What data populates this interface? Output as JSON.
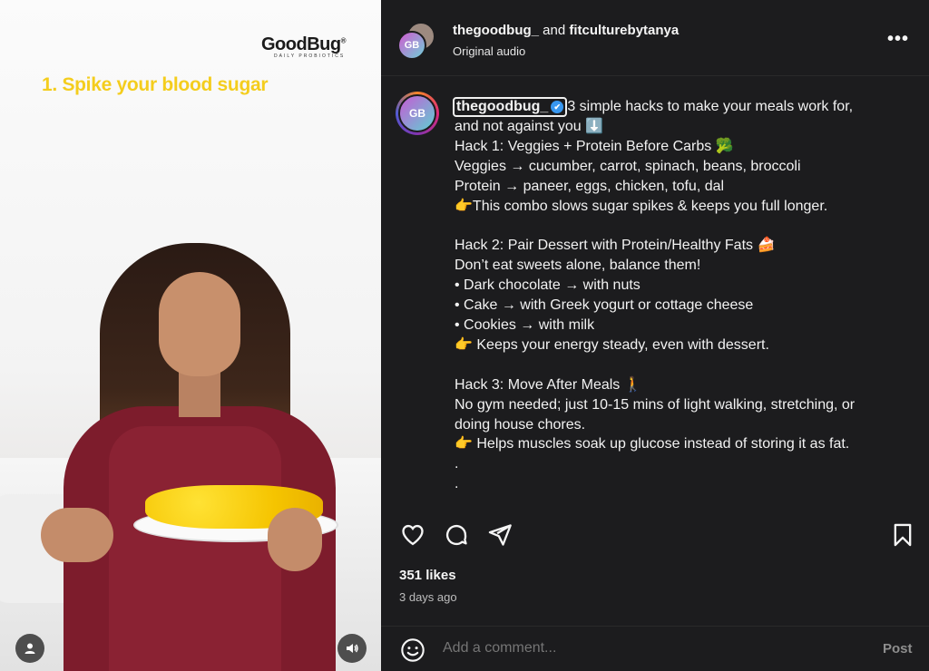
{
  "video": {
    "brand_logo": "GoodBug",
    "brand_sub": "DAILY PROBIOTICS",
    "brand_reg": "®",
    "overlay_caption": "1. Spike your blood sugar",
    "user_icon": "user-icon",
    "audio_icon": "speaker-icon"
  },
  "header": {
    "avatar_text": "GB",
    "author": "thegoodbug_",
    "conjunction": " and ",
    "coauthor": "fitculturebytanya",
    "audio_label": "Original audio",
    "more_label": "•••"
  },
  "post": {
    "avatar_text": "GB",
    "username": "thegoodbug_",
    "verified_glyph": "✔",
    "caption_lines": [
      "3 simple hacks to make your meals work for,",
      "and not against you ⬇️",
      "Hack 1: Veggies + Protein Before Carbs 🥦",
      "Veggies → cucumber, carrot, spinach, beans, broccoli",
      "Protein → paneer, eggs, chicken, tofu, dal",
      "👉This combo slows sugar spikes & keeps you full longer.",
      "",
      "Hack 2: Pair Dessert with Protein/Healthy Fats 🍰",
      "Don’t eat sweets alone, balance them!",
      "• Dark chocolate → with nuts",
      "• Cake → with Greek yogurt or cottage cheese",
      "• Cookies → with milk",
      "👉 Keeps your energy steady, even with dessert.",
      "",
      "Hack 3: Move After Meals 🚶",
      "No gym needed; just 10-15 mins of light walking, stretching, or",
      "doing house chores.",
      "👉 Helps muscles soak up glucose instead of storing it as fat.",
      ".",
      "."
    ]
  },
  "actions": {
    "like_icon": "heart-icon",
    "comment_icon": "comment-icon",
    "share_icon": "share-icon",
    "save_icon": "bookmark-icon"
  },
  "stats": {
    "likes": "351 likes",
    "time": "3 days ago"
  },
  "comment": {
    "placeholder": "Add a comment...",
    "post_label": "Post",
    "emoji_icon": "emoji-icon"
  },
  "colors": {
    "panel_bg": "#1c1c1e",
    "caption_yellow": "#f4cd1d",
    "verified_blue": "#3897f0",
    "dress": "#7d1c2c"
  }
}
